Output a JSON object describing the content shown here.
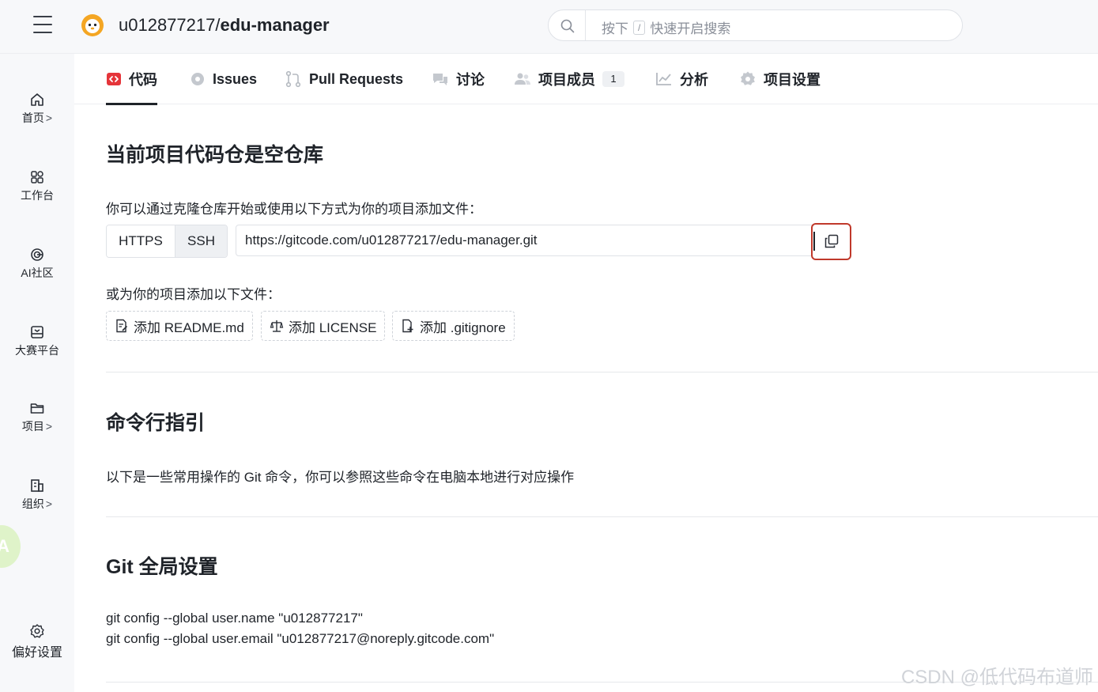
{
  "header": {
    "owner": "u012877217/",
    "repo": "edu-manager",
    "search_prefix": "按下",
    "search_key": "/",
    "search_suffix": "快速开启搜索"
  },
  "sidebar": {
    "items": [
      {
        "label": "首页",
        "icon": "home-icon",
        "chevron": ">"
      },
      {
        "label": "工作台",
        "icon": "grid-icon",
        "chevron": ""
      },
      {
        "label": "AI社区",
        "icon": "ai-icon",
        "chevron": ""
      },
      {
        "label": "大赛平台",
        "icon": "trophy-icon",
        "chevron": ""
      },
      {
        "label": "项目",
        "icon": "folder-icon",
        "chevron": ">"
      },
      {
        "label": "组织",
        "icon": "building-icon",
        "chevron": ">"
      }
    ],
    "float_badge": "A",
    "preferences": "偏好设置"
  },
  "tabs": [
    {
      "label": "代码",
      "icon": "code-icon",
      "active": true
    },
    {
      "label": "Issues",
      "icon": "issue-icon"
    },
    {
      "label": "Pull Requests",
      "icon": "pull-request-icon"
    },
    {
      "label": "讨论",
      "icon": "discussion-icon"
    },
    {
      "label": "项目成员",
      "icon": "members-icon",
      "count": "1"
    },
    {
      "label": "分析",
      "icon": "chart-icon"
    },
    {
      "label": "项目设置",
      "icon": "settings-icon"
    }
  ],
  "empty_repo": {
    "title": "当前项目代码仓是空仓库",
    "intro": "你可以通过克隆仓库开始或使用以下方式为你的项目添加文件：",
    "protocols": [
      "HTTPS",
      "SSH"
    ],
    "selected_protocol": "SSH",
    "clone_url": "https://gitcode.com/u012877217/edu-manager.git",
    "add_files_label": "或为你的项目添加以下文件：",
    "add_buttons": [
      "添加 README.md",
      "添加 LICENSE",
      "添加 .gitignore"
    ]
  },
  "command_line": {
    "title": "命令行指引",
    "desc": "以下是一些常用操作的 Git 命令，你可以参照这些命令在电脑本地进行对应操作"
  },
  "git_global": {
    "title": "Git 全局设置",
    "lines": [
      "git config --global user.name \"u012877217\"",
      "git config --global user.email \"u012877217@noreply.gitcode.com\""
    ]
  },
  "watermark": "CSDN @低代码布道师",
  "colors": {
    "accent_red": "#e5353a",
    "highlight_border": "#c0392b"
  }
}
